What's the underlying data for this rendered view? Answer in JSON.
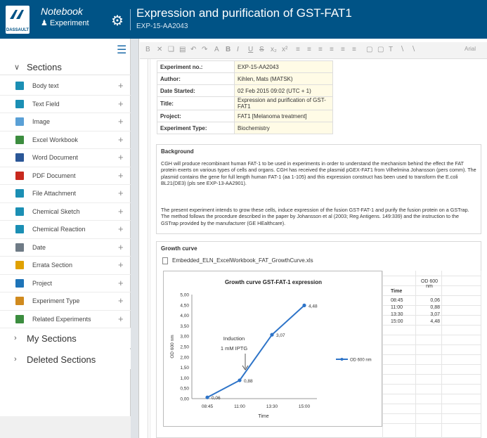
{
  "header": {
    "logo_text": "DASSAULT",
    "app_name": "Notebook",
    "app_sub": "Experiment",
    "title": "Expression and purification of GST-FAT1",
    "exp_id": "EXP-15-AA2043"
  },
  "sidebar": {
    "sections_label": "Sections",
    "items": [
      {
        "label": "Body text",
        "icon": "body-text-icon",
        "color": "#1b8fb4"
      },
      {
        "label": "Text Field",
        "icon": "text-field-icon",
        "color": "#1b8fb4"
      },
      {
        "label": "Image",
        "icon": "image-icon",
        "color": "#5aa0d6"
      },
      {
        "label": "Excel Workbook",
        "icon": "excel-icon",
        "color": "#3c8d3f"
      },
      {
        "label": "Word Document",
        "icon": "word-icon",
        "color": "#2b5797"
      },
      {
        "label": "PDF Document",
        "icon": "pdf-icon",
        "color": "#c8291e"
      },
      {
        "label": "File Attachment",
        "icon": "file-attachment-icon",
        "color": "#1b8fb4"
      },
      {
        "label": "Chemical Sketch",
        "icon": "chemical-sketch-icon",
        "color": "#1b8fb4"
      },
      {
        "label": "Chemical Reaction",
        "icon": "chemical-reaction-icon",
        "color": "#1b8fb4"
      },
      {
        "label": "Date",
        "icon": "date-icon",
        "color": "#6f7b86"
      },
      {
        "label": "Errata Section",
        "icon": "errata-icon",
        "color": "#e0a100"
      },
      {
        "label": "Project",
        "icon": "folder-icon",
        "color": "#1e74b8"
      },
      {
        "label": "Experiment Type",
        "icon": "tag-icon",
        "color": "#d08a1e"
      },
      {
        "label": "Related Experiments",
        "icon": "related-icon",
        "color": "#3c8d3f"
      }
    ],
    "my_sections": "My Sections",
    "deleted_sections": "Deleted Sections"
  },
  "meta": {
    "rows": [
      {
        "key": "Experiment no.:",
        "value": "EXP-15-AA2043"
      },
      {
        "key": "Author:",
        "value": "Kihlen, Mats (MATSK)"
      },
      {
        "key": "Date Started:",
        "value": "02 Feb 2015 09:02 (UTC + 1)"
      },
      {
        "key": "Title:",
        "value": "Expression and purification of GST-FAT1"
      },
      {
        "key": "Project:",
        "value": "FAT1 [Melanoma treatment]"
      },
      {
        "key": "Experiment Type:",
        "value": "Biochemistry"
      }
    ]
  },
  "background": {
    "title": "Background",
    "p1": "CGH will produce recombinant human FAT-1 to be used in experiments in order to understand the mechanism behind the effect the FAT protein exerts on various types of cells and organs. CGH has received the plasmid pGEX-FAT1 from Vilhelmina Johansson (pers comm). The plasmid contains the gene for full length human FAT-1 (aa 1-105) and this expression construct has been used to transform the E.coli BL21(DE3) (pls see EXP-13-AA2901).",
    "p2": "The present experiment intends to grow these cells, induce expression of the fusion GST-FAT-1 and purify the fusion protein on a GSTrap. The method follows the procedure described in the paper by Johansson et al (2003; Reg Antigens. 149:339) and the instruction to the GSTrap provided by the manufacturer (GE HEalthcare)."
  },
  "growth": {
    "title": "Growth curve",
    "file": "Embedded_ELN_ExcelWorkbook_FAT_GrowthCurve.xls",
    "sheet_headers": [
      "Time",
      "OD 600 nm"
    ],
    "sheet_rows": [
      [
        "08:45",
        "0,06"
      ],
      [
        "11:00",
        "0,88"
      ],
      [
        "13:30",
        "3,07"
      ],
      [
        "15:00",
        "4,48"
      ]
    ]
  },
  "chart_data": {
    "type": "line",
    "title": "Growth curve GST-FAT-1 expression",
    "xlabel": "Time",
    "ylabel": "OD 600 nm",
    "categories": [
      "08:45",
      "11:00",
      "13:30",
      "15:00"
    ],
    "series": [
      {
        "name": "OD 600 nm",
        "values": [
          0.06,
          0.88,
          3.07,
          4.48
        ],
        "labels": [
          "0,06",
          "0,88",
          "3,07",
          "4,48"
        ],
        "color": "#2e74c8"
      }
    ],
    "yticks": [
      "0,00",
      "0,50",
      "1,00",
      "1,50",
      "2,00",
      "2,50",
      "3,00",
      "3,50",
      "4,00",
      "4,50",
      "5,00"
    ],
    "ylim": [
      0,
      5
    ],
    "annotation": [
      "Induction",
      "1 mM IPTG"
    ],
    "legend": "right"
  }
}
